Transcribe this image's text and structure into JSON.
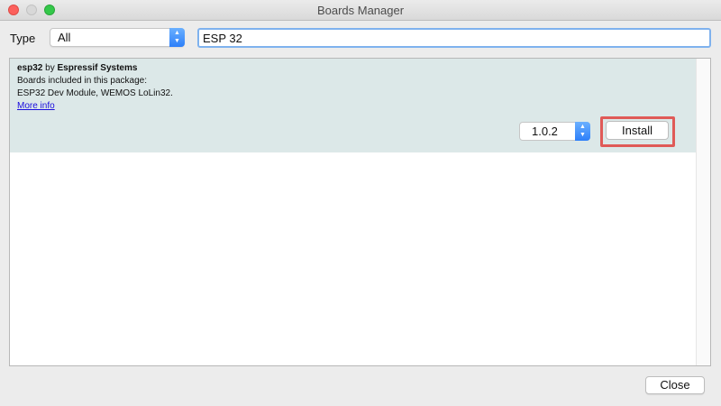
{
  "window": {
    "title": "Boards Manager"
  },
  "filter": {
    "type_label": "Type",
    "type_value": "All",
    "search_value": "ESP 32"
  },
  "board": {
    "name": "esp32",
    "by": "by",
    "author": "Espressif Systems",
    "boards_heading": "Boards included in this package:",
    "boards_list": "ESP32 Dev Module, WEMOS LoLin32.",
    "more_info": "More info",
    "version": "1.0.2",
    "install_label": "Install"
  },
  "footer": {
    "close_label": "Close"
  },
  "icons": {
    "stepper_up": "▲",
    "stepper_down": "▼"
  },
  "colors": {
    "entry_background": "#dce8e8",
    "highlight_border": "#e05a57",
    "link": "#1a0dde",
    "stepper": "#2d7ff9"
  }
}
